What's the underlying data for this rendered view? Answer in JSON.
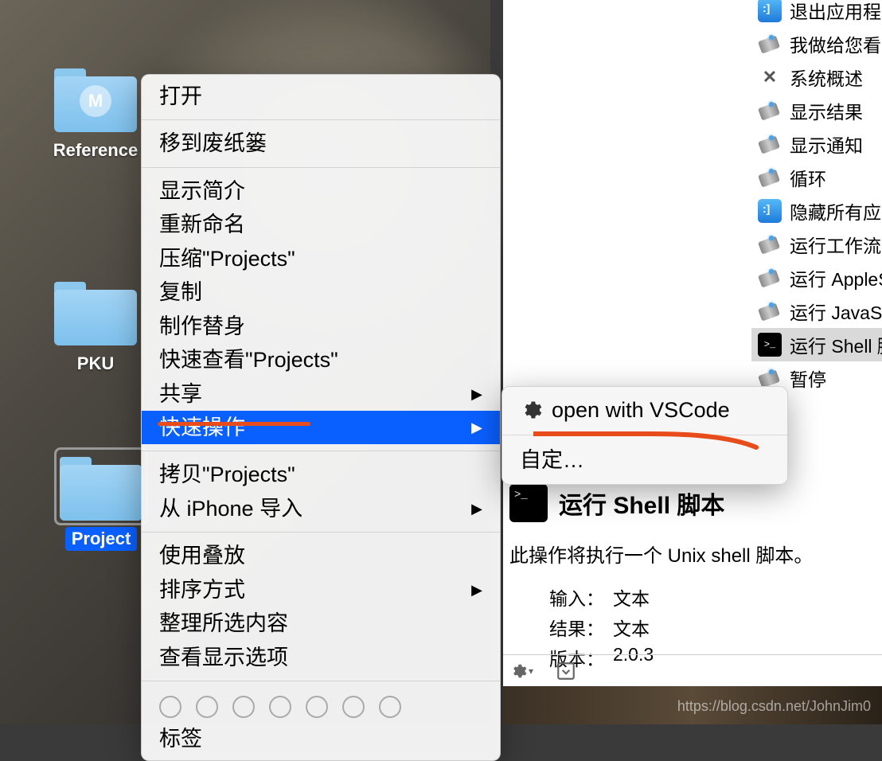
{
  "desktop": {
    "folders": [
      {
        "label": "Reference",
        "badge": "M",
        "selected": false
      },
      {
        "label": "PKU",
        "badge": "",
        "selected": false
      },
      {
        "label": "Project",
        "badge": "",
        "selected": true
      }
    ]
  },
  "context_menu": {
    "open": "打开",
    "trash": "移到废纸篓",
    "info": "显示简介",
    "rename": "重新命名",
    "compress": "压缩\"Projects\"",
    "copy": "复制",
    "alias": "制作替身",
    "quicklook": "快速查看\"Projects\"",
    "share": "共享",
    "quick_actions": "快速操作",
    "copy_path": "拷贝\"Projects\"",
    "import_iphone": "从 iPhone 导入",
    "use_stacks": "使用叠放",
    "sort_by": "排序方式",
    "clean_up": "整理所选内容",
    "view_options": "查看显示选项",
    "tags": "标签"
  },
  "submenu": {
    "open_vscode": "open with VSCode",
    "customize": "自定…"
  },
  "actions_list": [
    {
      "icon": "finder",
      "label": "退出应用程"
    },
    {
      "icon": "automator",
      "label": "我做给您看"
    },
    {
      "icon": "tools",
      "label": "系统概述"
    },
    {
      "icon": "automator",
      "label": "显示结果"
    },
    {
      "icon": "automator",
      "label": "显示通知"
    },
    {
      "icon": "automator",
      "label": "循环"
    },
    {
      "icon": "finder",
      "label": "隐藏所有应"
    },
    {
      "icon": "automator",
      "label": "运行工作流"
    },
    {
      "icon": "automator",
      "label": "运行 AppleS"
    },
    {
      "icon": "automator",
      "label": "运行 JavaSc"
    },
    {
      "icon": "terminal",
      "label": "运行 Shell 脚"
    },
    {
      "icon": "automator",
      "label": "暂停"
    }
  ],
  "actions_selected_index": 10,
  "detail": {
    "title": "运行 Shell 脚本",
    "desc": "此操作将执行一个 Unix shell 脚本。",
    "input_key": "输入：",
    "input_val": "文本",
    "result_key": "结果：",
    "result_val": "文本",
    "version_key": "版本：",
    "version_val": "2.0.3"
  },
  "watermark": "https://blog.csdn.net/JohnJim0"
}
